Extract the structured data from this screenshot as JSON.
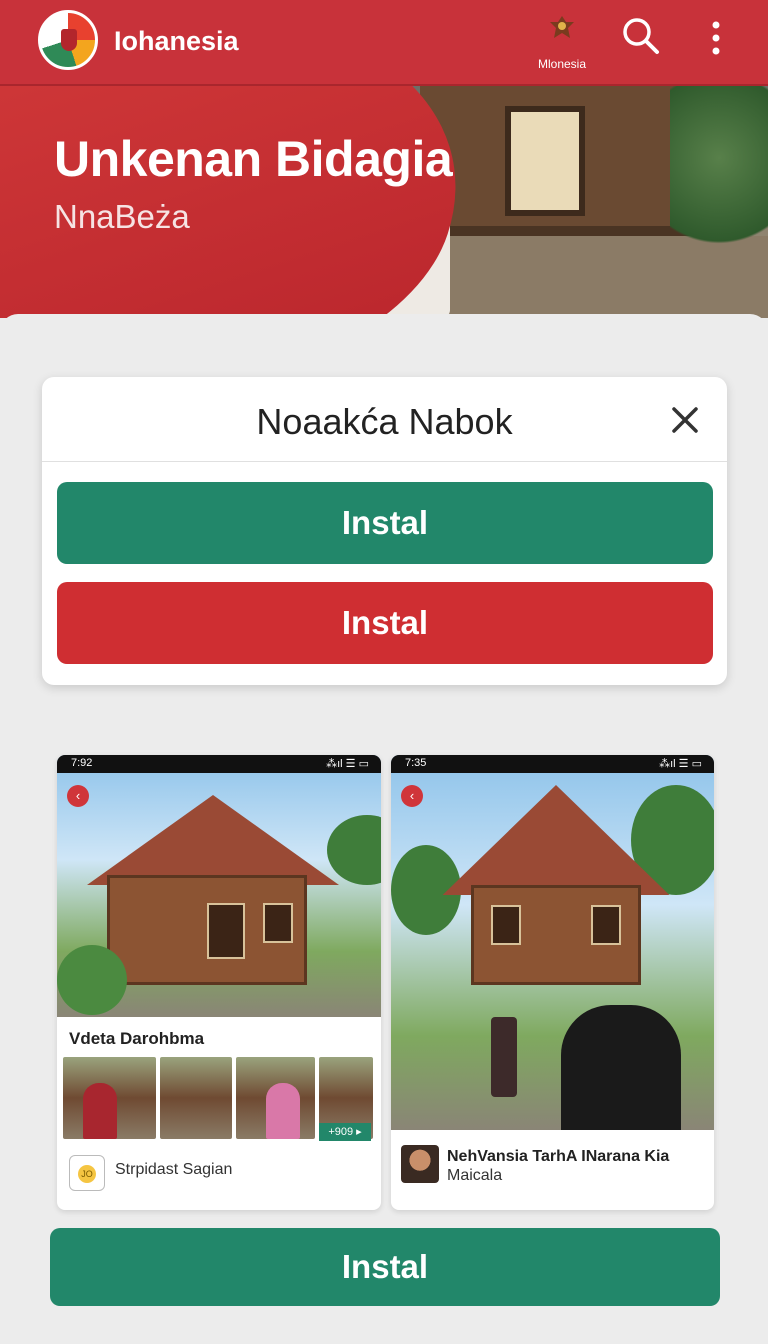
{
  "app": {
    "title": "Iohanesia",
    "emblem_label": "Mlonesia"
  },
  "hero": {
    "title": "Unkenan Bidagia",
    "subtitle": "NnaBeża"
  },
  "dialog": {
    "title": "Noaakća Nabok",
    "primary_label": "Instal",
    "secondary_label": "Instal"
  },
  "screenshots": [
    {
      "time": "7:92",
      "signal": "⁂ıl ☰ ▭",
      "title": "Vdeta Darohbma",
      "badge": "+909 ▸",
      "footer": "Strpidast Sagian"
    },
    {
      "time": "7:35",
      "signal": "⁂ıl ☰ ▭",
      "title": "NehVansia TarhA INarana Kia",
      "subtitle": "Maicala"
    }
  ],
  "bottom_button": {
    "label": "Instal"
  },
  "colors": {
    "brand_red": "#c8323a",
    "install_green": "#22876a",
    "install_red": "#cf2e32"
  }
}
